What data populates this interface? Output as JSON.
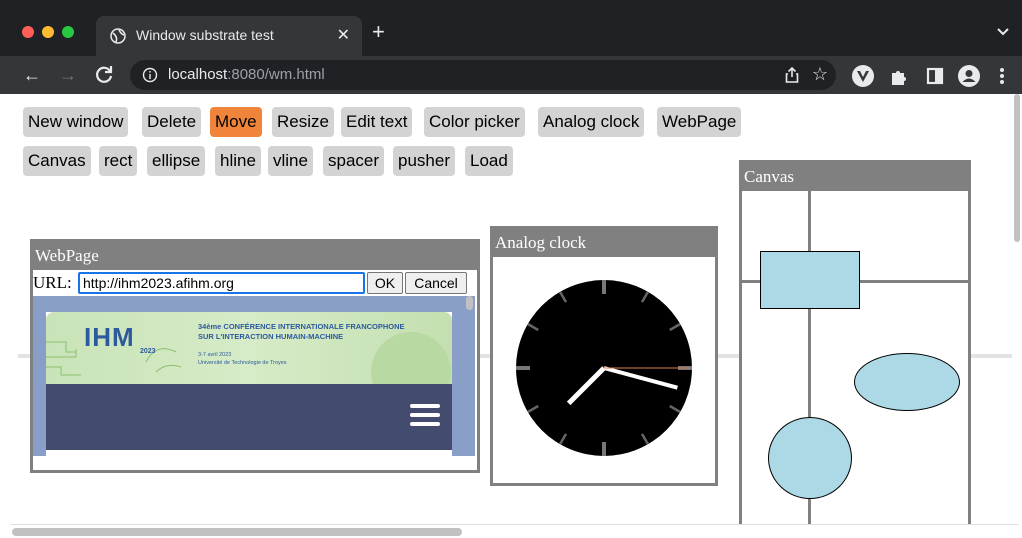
{
  "browser": {
    "tab_title": "Window substrate test",
    "tab_close": "✕",
    "new_tab": "+",
    "url_host": "localhost",
    "url_rest": ":8080/wm.html",
    "back": "←",
    "forward": "→",
    "reload": "C",
    "star": "☆"
  },
  "toolbar_row1": [
    "New window",
    "Delete",
    "Move",
    "Resize",
    "Edit text",
    "Color picker",
    "Analog clock",
    "WebPage"
  ],
  "toolbar_row2": [
    "Canvas",
    "rect",
    "ellipse",
    "hline",
    "vline",
    "spacer",
    "pusher",
    "Load"
  ],
  "active_tool": "Move",
  "windows": {
    "webpage": {
      "title": "WebPage",
      "url_label": "URL:",
      "url_value": "http://ihm2023.afihm.org",
      "ok": "OK",
      "cancel": "Cancel",
      "site": {
        "logo": "IHM",
        "year": "2023",
        "line1": "34ème CONFÉRENCE INTERNATIONALE FRANCOPHONE",
        "line2": "SUR L'INTERACTION HUMAIN-MACHINE",
        "line3": "3-7 avril 2023",
        "line4": "Université de Technologie de Troyes"
      }
    },
    "clock": {
      "title": "Analog clock",
      "hour": 7.5,
      "minute": 17.5,
      "second": 15
    },
    "canvas": {
      "title": "Canvas"
    }
  },
  "colors": {
    "active_button": "#f0843a",
    "button": "#d3d3d3",
    "window_border": "#808080",
    "shape_fill": "#add8e6"
  }
}
